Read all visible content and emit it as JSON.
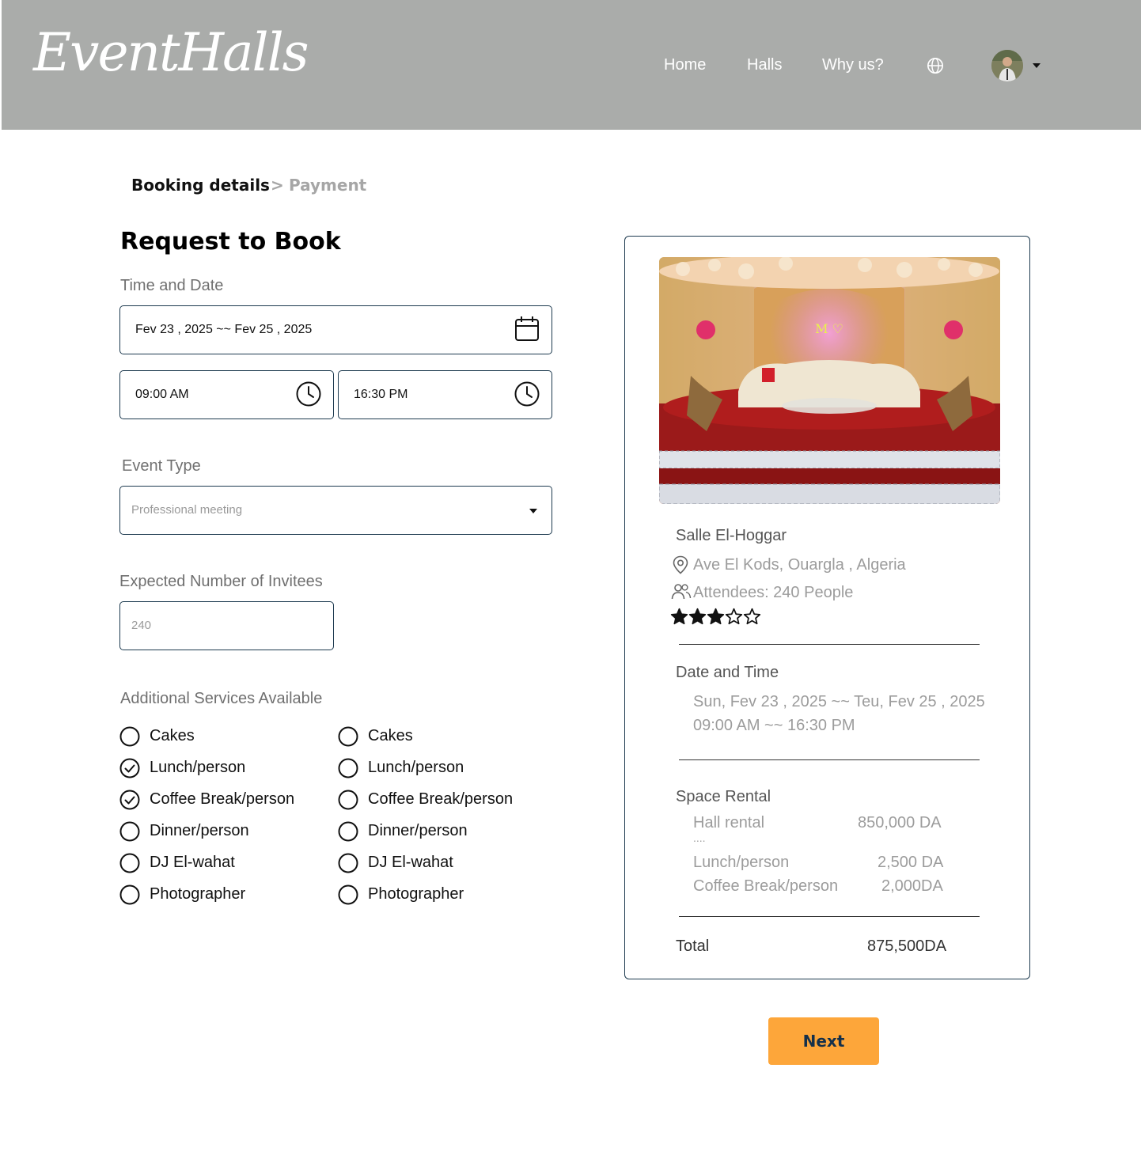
{
  "header": {
    "logo": "EventHalls",
    "nav": {
      "home": "Home",
      "halls": "Halls",
      "why_us": "Why us?"
    }
  },
  "breadcrumb": {
    "current": "Booking details",
    "separator": ">",
    "next": "Payment"
  },
  "form": {
    "title": "Request to Book",
    "time_date_label": "Time and Date",
    "date_range": "Fev 23 , 2025 ~~ Fev 25 , 2025",
    "start_time": "09:00 AM",
    "end_time": "16:30 PM",
    "event_type_label": "Event Type",
    "event_type_placeholder": "Professional meeting",
    "invitees_label": "Expected Number of Invitees",
    "invitees_placeholder": "240",
    "services_label": "Additional Services Available",
    "services_left": [
      {
        "label": "Cakes",
        "checked": false
      },
      {
        "label": "Lunch/person",
        "checked": true
      },
      {
        "label": "Coffee Break/person",
        "checked": true
      },
      {
        "label": "Dinner/person",
        "checked": false
      },
      {
        "label": "DJ El-wahat",
        "checked": false
      },
      {
        "label": "Photographer",
        "checked": false
      }
    ],
    "services_right": [
      {
        "label": "Cakes",
        "checked": false
      },
      {
        "label": "Lunch/person",
        "checked": false
      },
      {
        "label": "Coffee Break/person",
        "checked": false
      },
      {
        "label": "Dinner/person",
        "checked": false
      },
      {
        "label": "DJ El-wahat",
        "checked": false
      },
      {
        "label": "Photographer",
        "checked": false
      }
    ]
  },
  "summary": {
    "hall_name": "Salle El-Hoggar",
    "address": "Ave El Kods, Ouargla , Algeria",
    "attendees": "Attendees: 240 People",
    "rating": 3,
    "rating_max": 5,
    "date_time_label": "Date and Time",
    "date_line": "Sun, Fev 23 , 2025 ~~ Teu, Fev 25 , 2025",
    "time_line": "09:00 AM ~~ 16:30 PM",
    "space_rental_label": "Space Rental",
    "hall_rental_label": "Hall rental",
    "hall_rental_value": "850,000 DA",
    "ellipsis": "....",
    "lunch_label": "Lunch/person",
    "lunch_value": "2,500 DA",
    "coffee_label": "Coffee Break/person",
    "coffee_value": "2,000DA",
    "total_label": "Total",
    "total_value": "875,500DA"
  },
  "actions": {
    "next": "Next"
  },
  "colors": {
    "header_bg": "#aaacaa",
    "field_border": "#1d3a4f",
    "button_bg": "#fda63a",
    "button_text": "#15304a",
    "crumb_inactive": "#a6a6a6"
  }
}
